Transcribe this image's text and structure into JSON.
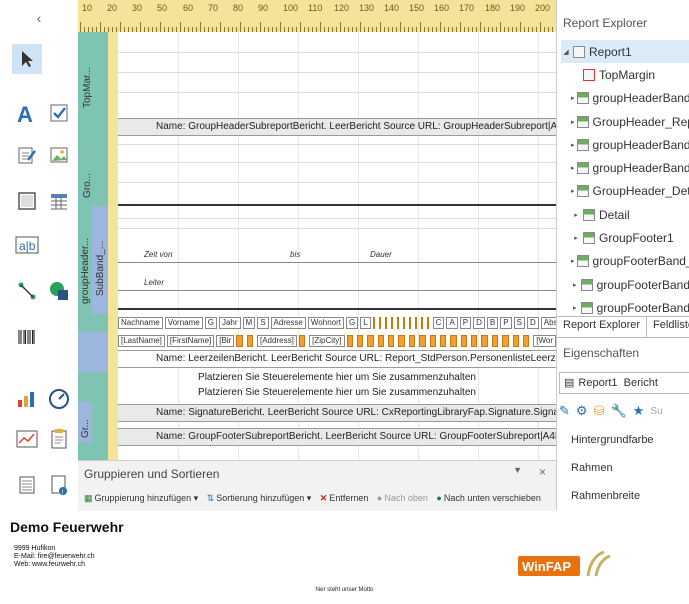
{
  "toolbox": {
    "collapse_glyph": "‹"
  },
  "ruler": {
    "numbers": [
      "10",
      "20",
      "30",
      "50",
      "60",
      "70",
      "80",
      "90",
      "100",
      "110",
      "120",
      "130",
      "140",
      "150",
      "160",
      "170",
      "180",
      "190",
      "200"
    ]
  },
  "bands": {
    "top_margin": "TopMar...",
    "group_header": "Gro...",
    "group_header_band": "groupHeader...",
    "subband": "SubBand_...",
    "gr": "Gr..."
  },
  "designer": {
    "group_header_subreport": "Name: GroupHeaderSubreportBericht. LeerBericht Source URL: GroupHeaderSubreport|A4Landscap",
    "zeit_von": "Zeit von",
    "bis": "bis",
    "dauer": "Dauer",
    "leiter": "Leiter",
    "header_cells": [
      "Nachname",
      "Vorname",
      "G",
      "Jahr",
      "M",
      "S",
      "Adresse",
      "Wohnort",
      "G",
      "L"
    ],
    "header_cells_end": [
      "C",
      "A",
      "P",
      "D",
      "B",
      "P",
      "S",
      "D",
      "Abse"
    ],
    "data_cells": [
      "[LastName]",
      "[FirstName]",
      "[Bir",
      "[Address]",
      "[ZipCity]"
    ],
    "data_end": "[Wor",
    "leerzeilen": "Name: LeerzeilenBericht. LeerBericht Source URL: Report_StdPerson.PersonenlisteLeerzeilenLandscap",
    "placeholder1": "Platzieren Sie Steuerelemente hier um Sie zusammenzuhalten",
    "placeholder2": "Platzieren Sie Steuerelemente hier um Sie zusammenzuhalten",
    "signature": "Name: SignatureBericht. LeerBericht Source URL: CxReportingLibraryFap.Signature.SignatureLandsc",
    "group_footer_subreport": "Name: GroupFooterSubreportBericht. LeerBericht Source URL: GroupFooterSubreport|A4Landscap"
  },
  "grouping": {
    "title": "Gruppieren und Sortieren",
    "pin": "▼",
    "close": "×",
    "add_group": "Gruppierung hinzufügen",
    "add_sort": "Sortierung hinzufügen",
    "remove": "Entfernen",
    "move_up": "Nach oben",
    "move_down": "Nach unten verschieben"
  },
  "explorer": {
    "title": "Report Explorer",
    "items": [
      {
        "label": "Report1",
        "arrow": "◢",
        "selected": true
      },
      {
        "label": "TopMargin",
        "arrow": "",
        "selected": false
      },
      {
        "label": "groupHeaderBand_",
        "arrow": "▸",
        "selected": false
      },
      {
        "label": "GroupHeader_Repo",
        "arrow": "▸",
        "selected": false
      },
      {
        "label": "groupHeaderBand_",
        "arrow": "▸",
        "selected": false
      },
      {
        "label": "groupHeaderBand_",
        "arrow": "▸",
        "selected": false
      },
      {
        "label": "GroupHeader_Deta",
        "arrow": "▸",
        "selected": false
      },
      {
        "label": "Detail",
        "arrow": "▸",
        "selected": false
      },
      {
        "label": "GroupFooter1",
        "arrow": "▸",
        "selected": false
      },
      {
        "label": "groupFooterBand_",
        "arrow": "▸",
        "selected": false
      },
      {
        "label": "groupFooterBand",
        "arrow": "▸",
        "selected": false
      },
      {
        "label": "groupFooterBand",
        "arrow": "▸",
        "selected": false
      }
    ],
    "tabs": [
      "Report Explorer",
      "Feldliste"
    ]
  },
  "properties": {
    "title": "Eigenschaften",
    "combo_name": "Report1",
    "combo_type": "Bericht",
    "search_placeholder": "Su",
    "items": [
      "Hintergrundfarbe",
      "Rahmen",
      "Rahmenbreite"
    ]
  },
  "document": {
    "title": "Demo Feuerwehr",
    "lines": [
      "9999 Hufikon",
      "E-Mail: fire@feuerwehr.ch",
      "Web: www.feurwehr.ch"
    ],
    "motto": "hier steht unser Motto",
    "logo_text": "WinFAP"
  }
}
